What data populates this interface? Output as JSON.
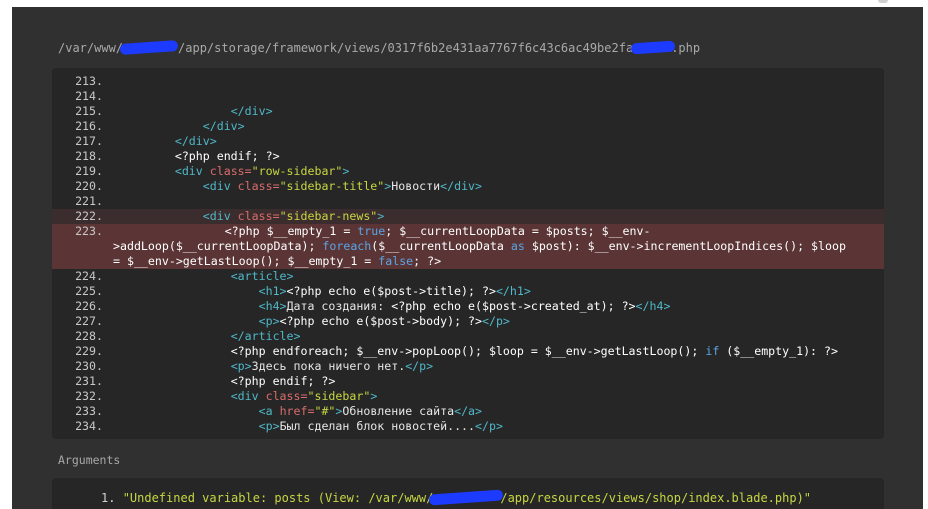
{
  "file_path": {
    "prefix": "/var/www/",
    "middle": "/app/storage/framework/views/0317f6b2e431aa7767f6c43c6ac49be2fa",
    "suffix": ".php"
  },
  "code_lines": [
    {
      "num": "213.",
      "text": ""
    },
    {
      "num": "214.",
      "text": ""
    },
    {
      "num": "215.",
      "indent": "                ",
      "tag": "</div>"
    },
    {
      "num": "216.",
      "indent": "            ",
      "tag": "</div>"
    },
    {
      "num": "217.",
      "indent": "        ",
      "tag": "</div>"
    },
    {
      "num": "218.",
      "indent": "        ",
      "php": "<?php endif; ?>"
    },
    {
      "num": "219.",
      "indent": "        ",
      "tag_open": "<div ",
      "attr": "class=",
      "str": "\"row-sidebar\"",
      "tag_close": ">"
    },
    {
      "num": "220.",
      "indent": "            ",
      "tag_open": "<div ",
      "attr": "class=",
      "str": "\"sidebar-title\"",
      "tag_close": ">",
      "content": "Новости",
      "tag_end": "</div>"
    },
    {
      "num": "221.",
      "text": ""
    },
    {
      "num": "222.",
      "indent": "            ",
      "tag_open": "<div ",
      "attr": "class=",
      "str": "\"sidebar-news\"",
      "tag_close": ">"
    },
    {
      "num": "224.",
      "indent": "                ",
      "tag": "<article>"
    },
    {
      "num": "225.",
      "indent": "                    ",
      "tag_open": "<h1>",
      "php": "<?php echo e($post->title); ?>",
      "tag_end": "</h1>"
    },
    {
      "num": "226.",
      "indent": "                    ",
      "tag_open": "<h4>",
      "content": "Дата создания: ",
      "php": "<?php echo e($post->created_at); ?>",
      "tag_end": "</h4>"
    },
    {
      "num": "227.",
      "indent": "                    ",
      "tag_open": "<p>",
      "php": "<?php echo e($post->body); ?>",
      "tag_end": "</p>"
    },
    {
      "num": "228.",
      "indent": "                ",
      "tag": "</article>"
    },
    {
      "num": "230.",
      "indent": "                ",
      "tag_open": "<p>",
      "content": "Здесь пока ничего нет.",
      "tag_end": "</p>"
    },
    {
      "num": "231.",
      "indent": "                ",
      "php": "<?php endif; ?>"
    },
    {
      "num": "232.",
      "indent": "                ",
      "tag_open": "<div ",
      "attr": "class=",
      "str": "\"sidebar\"",
      "tag_close": ">"
    },
    {
      "num": "233.",
      "indent": "                    ",
      "tag_open": "<a ",
      "attr": "href=",
      "str": "\"#\"",
      "tag_close": ">",
      "content": "Обновление сайта",
      "tag_end": "</a>"
    },
    {
      "num": "234.",
      "indent": "                    ",
      "tag_open": "<p>",
      "content": "Был сделан блок новостей....",
      "tag_end": "</p>"
    }
  ],
  "highlighted_line": {
    "num": "223.",
    "part1": "<?php $__empty_1 = ",
    "kw_true": "true",
    "part2": "; $__currentLoopData = $posts; $__env-\n>addLoop($__currentLoopData); ",
    "kw_foreach": "foreach",
    "part3": "($__currentLoopData ",
    "kw_as": "as",
    "part4": " $post): $__env->incrementLoopIndices(); $loop\n= $__env->getLastLoop(); $__empty_1 = ",
    "kw_false": "false",
    "part5": "; ?>"
  },
  "line_229": {
    "num": "229.",
    "part1": "<?php endforeach; $__env->popLoop(); $loop = $__env->getLastLoop(); ",
    "kw_if": "if",
    "part2": " ($__empty_1): ?>"
  },
  "arguments": {
    "title": "Arguments",
    "item_number": "1.",
    "item_prefix": "\"Undefined variable: posts (View: /var/www/",
    "item_suffix": "/app/resources/views/shop/index.blade.php)\""
  },
  "colors": {
    "panel_bg": "#303030",
    "code_bg": "#262626",
    "highlight_bg": "#5b3535",
    "tag": "#4fb8c9",
    "attr": "#d96c6c",
    "string": "#c7d742",
    "keyword": "#5ba4e6",
    "redaction": "#1d3bff"
  }
}
